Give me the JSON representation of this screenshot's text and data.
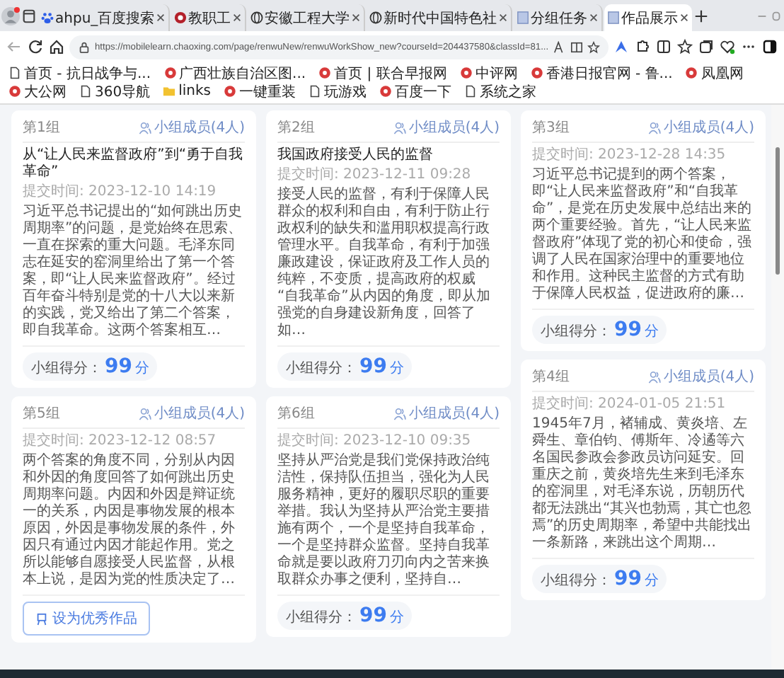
{
  "tabs": [
    {
      "kind": "paw",
      "label": "ahpu_百度搜索",
      "selected": false
    },
    {
      "kind": "emblem",
      "label": "教职工",
      "selected": false
    },
    {
      "kind": "globe",
      "label": "安徽工程大学",
      "selected": false
    },
    {
      "kind": "globe",
      "label": "新时代中国特色社",
      "selected": false
    },
    {
      "kind": "page",
      "label": "分组任务",
      "selected": false
    },
    {
      "kind": "page",
      "label": "作品展示",
      "selected": true
    }
  ],
  "address": {
    "url": "https://mobilelearn.chaoxing.com/page/renwuNew/renwuWorkShow_new?courseId=204437580&classId=81..."
  },
  "bookmarks": [
    {
      "kind": "page",
      "label": "首页 - 抗日战争与..."
    },
    {
      "kind": "site",
      "label": "广西壮族自治区图..."
    },
    {
      "kind": "site",
      "label": "首页 | 联合早报网"
    },
    {
      "kind": "site",
      "label": "中评网"
    },
    {
      "kind": "site",
      "label": "香港日报官网 - 鲁..."
    },
    {
      "kind": "site",
      "label": "凤凰网"
    },
    {
      "kind": "site",
      "label": "大公网"
    },
    {
      "kind": "page",
      "label": "360导航"
    },
    {
      "kind": "folder",
      "label": "links"
    },
    {
      "kind": "site",
      "label": "一键重装"
    },
    {
      "kind": "page",
      "label": "玩游戏"
    },
    {
      "kind": "site",
      "label": "百度一下"
    },
    {
      "kind": "page",
      "label": "系统之家"
    }
  ],
  "columns": [
    {
      "cards": [
        {
          "group": "第1组",
          "members": "小组成员(4人)",
          "title": "从“让人民来监督政府”到“勇于自我革命”",
          "time": "提交时间: 2023-12-10 14:19",
          "body": "习近平总书记提出的“如何跳出历史周期率”的问题，是党始终在思索、一直在探索的重大问题。毛泽东同志在延安的窑洞里给出了第一个答案，即“让人民来监督政府”。经过百年奋斗特别是党的十八大以来新的实践，党又给出了第二个答案，即自我革命。这两个答案相互…",
          "score_label": "小组得分：",
          "score": "99",
          "score_unit": "分"
        },
        {
          "group": "第5组",
          "members": "小组成员(4人)",
          "time": "提交时间: 2023-12-12 08:57",
          "body": "两个答案的角度不同，分别从内因和外因的角度回答了如何跳出历史周期率问题。内因和外因是辩证统一的关系，内因是事物发展的根本原因，外因是事物发展的条件，外因只有通过内因才能起作用。党之所以能够自愿接受人民监督，从根本上说，是因为党的性质决定了…",
          "button": "设为优秀作品"
        }
      ]
    },
    {
      "cards": [
        {
          "group": "第2组",
          "members": "小组成员(4人)",
          "title": "我国政府接受人民的监督",
          "time": "提交时间: 2023-12-11 09:28",
          "body": "接受人民的监督，有利于保障人民群众的权利和自由，有利于防止行政权利的缺失和滥用职权提高行政管理水平。自我革命，有利于加强廉政建设，保证政府及工作人员的纯粹，不变质，提高政府的权威 “自我革命”从内因的角度，即从加强党的自身建设新角度，回答了如…",
          "score_label": "小组得分：",
          "score": "99",
          "score_unit": "分"
        },
        {
          "group": "第6组",
          "members": "小组成员(4人)",
          "time": "提交时间: 2023-12-10 09:35",
          "body": "坚持从严治党是我们党保持政治纯洁性，保持队伍担当，强化为人民服务精神，更好的履职尽职的重要举措。我认为坚持从严治党主要措施有两个，一个是坚持自我革命，一个是坚持群众监督。坚持自我革命就是要以政府刀刃向内之苦来换取群众办事之便利，坚持自…",
          "score_label": "小组得分：",
          "score": "99",
          "score_unit": "分"
        }
      ]
    },
    {
      "cards": [
        {
          "group": "第3组",
          "members": "小组成员(4人)",
          "time": "提交时间: 2023-12-28 14:35",
          "body": "习近平总书记提到的两个答案，即“让人民来监督政府”和“自我革命”，是党在历史发展中总结出来的两个重要经验。首先，“让人民来监督政府”体现了党的初心和使命，强调了人民在国家治理中的重要地位和作用。这种民主监督的方式有助于保障人民权益，促进政府的廉…",
          "score_label": "小组得分：",
          "score": "99",
          "score_unit": "分"
        },
        {
          "group": "第4组",
          "members": "小组成员(4人)",
          "time": "提交时间: 2024-01-05 21:51",
          "body": "1945年7月，褚辅成、黄炎培、左舜生、章伯钧、傅斯年、冷遹等六名国民参政会参政员访问延安。回重庆之前，黄炎培先生来到毛泽东的窑洞里，对毛泽东说，历朝历代都无法跳出“其兴也勃焉，其亡也忽焉”的历史周期率，希望中共能找出一条新路，来跳出这个周期…",
          "score_label": "小组得分：",
          "score": "99",
          "score_unit": "分"
        }
      ]
    }
  ]
}
